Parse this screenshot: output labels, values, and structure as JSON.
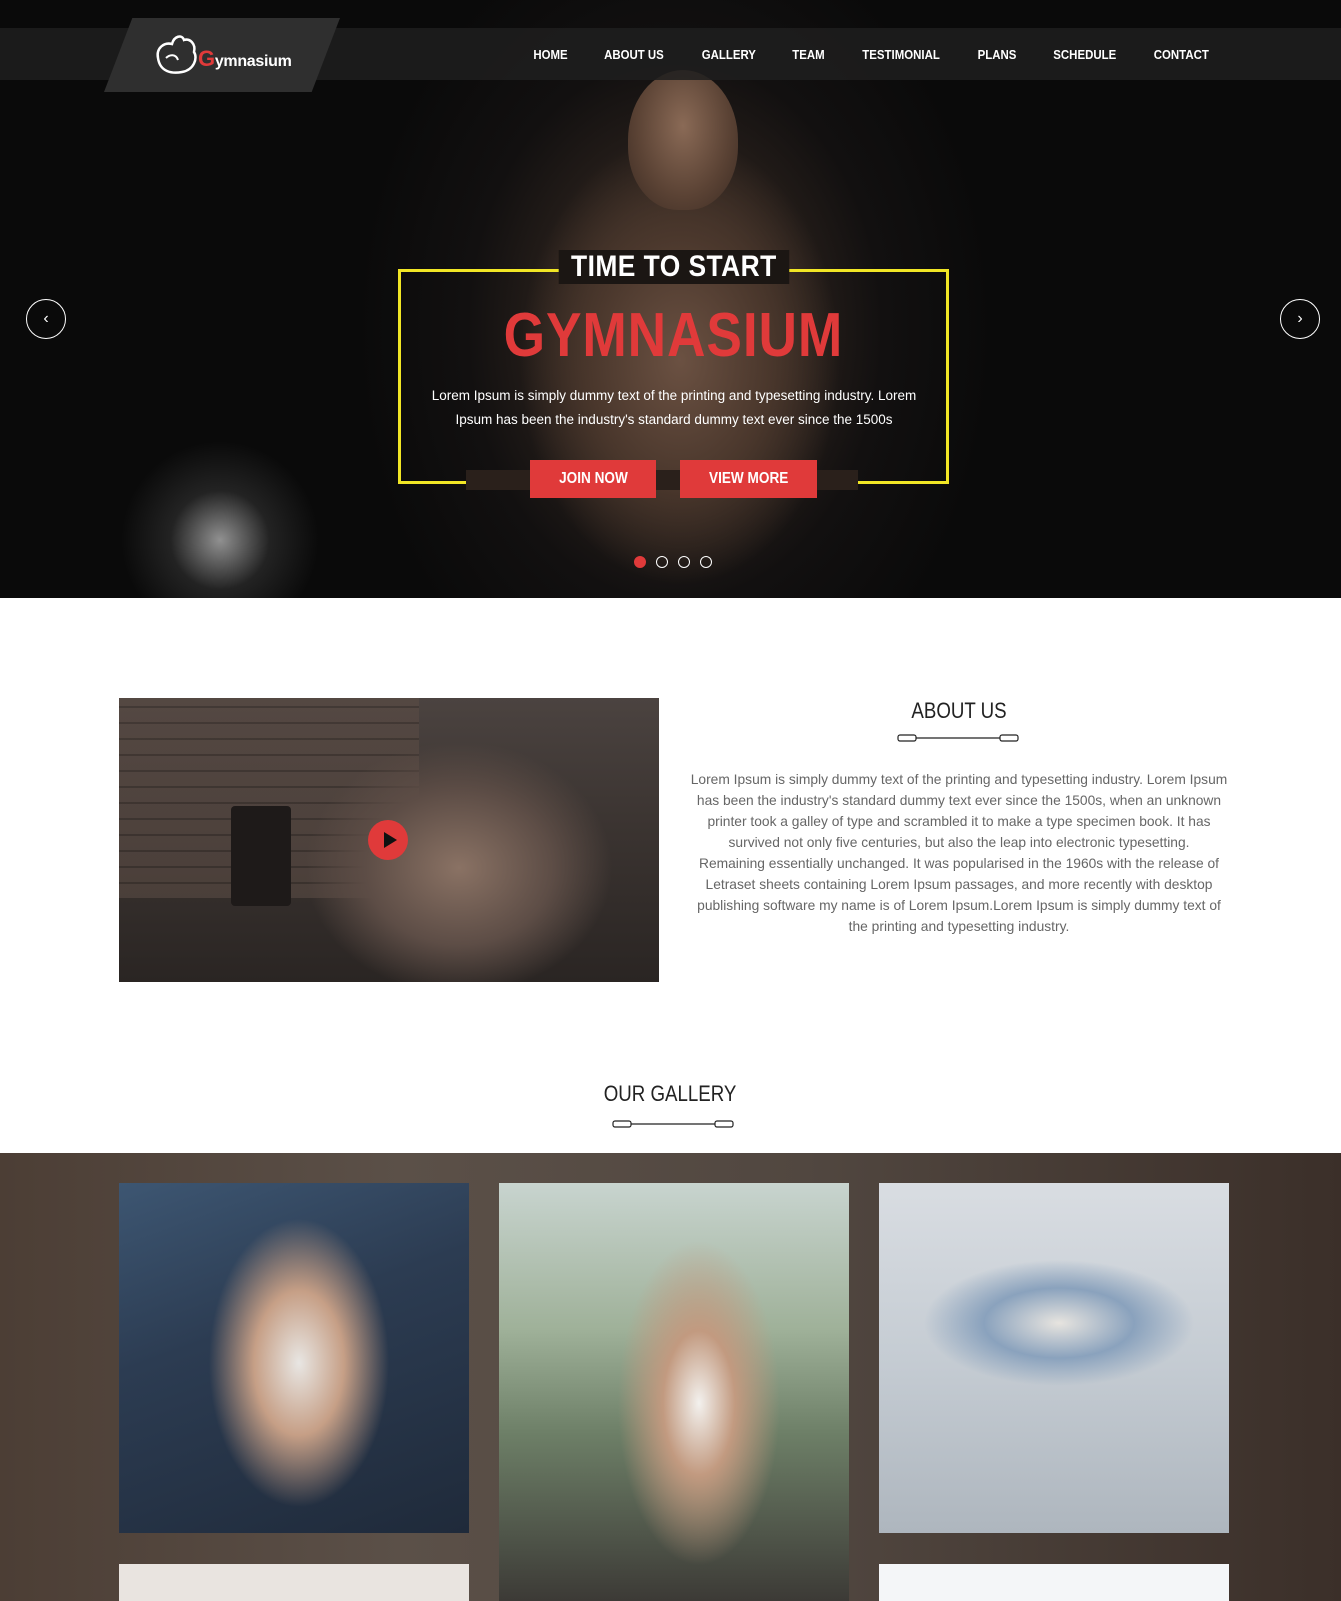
{
  "brand": {
    "logo_rest": "ymnasium",
    "logo_initial": "G"
  },
  "nav": {
    "items": [
      "HOME",
      "ABOUT US",
      "GALLERY",
      "TEAM",
      "TESTIMONIAL",
      "PLANS",
      "SCHEDULE",
      "CONTACT"
    ]
  },
  "hero": {
    "kicker": "TIME TO START",
    "title": "GYMNASIUM",
    "description": "Lorem Ipsum is simply dummy text of the printing and typesetting industry. Lorem Ipsum has been the industry's standard dummy text ever since the 1500s",
    "join_label": "JOIN NOW",
    "more_label": "VIEW MORE",
    "prev_icon": "‹",
    "next_icon": "›",
    "slides": 4,
    "active_slide": 1
  },
  "about": {
    "title": "ABOUT US",
    "paragraph1": "Lorem Ipsum is simply dummy text of the printing and typesetting industry. Lorem Ipsum has been the industry's standard dummy text ever since the 1500s, when an unknown printer took a galley of type and scrambled it to make a type specimen book. It has survived not only five centuries, but also the leap into electronic typesetting.",
    "paragraph2": "Remaining essentially unchanged. It was popularised in the 1960s with the release of Letraset sheets containing Lorem Ipsum passages, and more recently with desktop publishing software my name is of Lorem Ipsum.Lorem Ipsum is simply dummy text of the printing and typesetting industry."
  },
  "gallery": {
    "title": "OUR GALLERY"
  },
  "colors": {
    "accent": "#e03a3a",
    "frame": "#f1e625",
    "dark": "#0a0a0a"
  }
}
